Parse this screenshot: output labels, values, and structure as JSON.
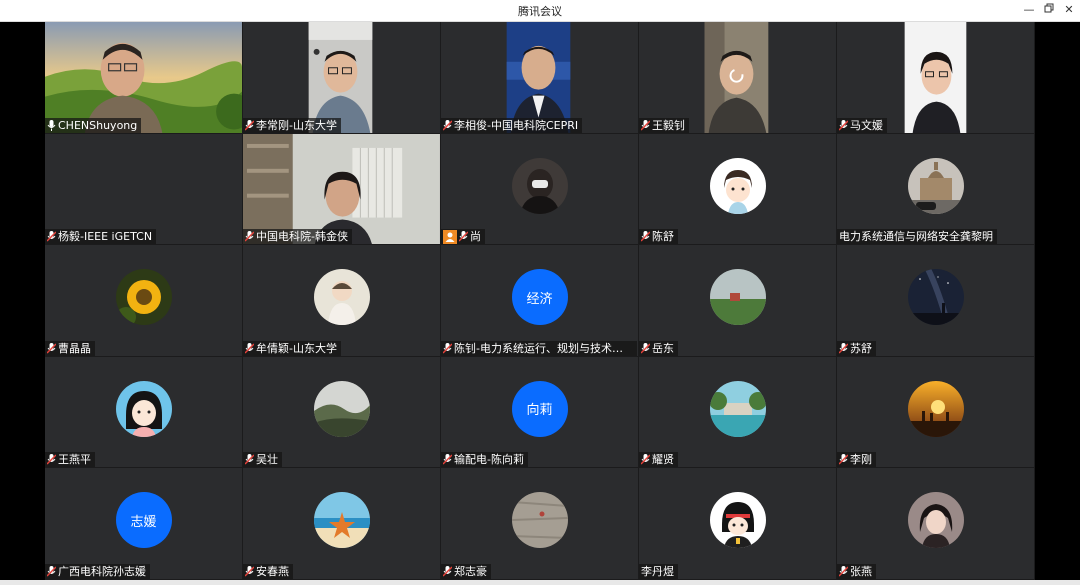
{
  "window": {
    "title": "腾讯会议",
    "minimize_icon": "minimize-icon",
    "restore_icon": "restore-icon",
    "close_icon": "close-icon"
  },
  "participants": [
    {
      "name": "CHENShuyong",
      "mic": "mic-on"
    },
    {
      "name": "李常刚-山东大学",
      "mic": "mic-muted"
    },
    {
      "name": "李相俊-中国电科院CEPRI",
      "mic": "mic-muted"
    },
    {
      "name": "王毅钊",
      "mic": "mic-muted"
    },
    {
      "name": "马文媛",
      "mic": "mic-muted"
    },
    {
      "name": "杨毅-IEEE iGETCN",
      "mic": "mic-muted"
    },
    {
      "name": "中国电科院-韩金侠",
      "mic": "mic-muted"
    },
    {
      "name": "尚",
      "mic": "mic-muted"
    },
    {
      "name": "陈舒",
      "mic": "mic-muted"
    },
    {
      "name": "电力系统通信与网络安全龚黎明",
      "mic": "none"
    },
    {
      "name": "曹晶晶",
      "mic": "mic-muted"
    },
    {
      "name": "牟倩颖-山东大学",
      "mic": "mic-muted"
    },
    {
      "name": "陈钊-电力系统运行、规划与技术经...",
      "mic": "mic-muted"
    },
    {
      "name": "岳东",
      "mic": "mic-muted"
    },
    {
      "name": "苏舒",
      "mic": "mic-muted"
    },
    {
      "name": "王燕平",
      "mic": "mic-muted"
    },
    {
      "name": "吴壮",
      "mic": "mic-muted"
    },
    {
      "name": "输配电-陈向莉",
      "mic": "mic-muted"
    },
    {
      "name": "耀贤",
      "mic": "mic-muted"
    },
    {
      "name": "李刚",
      "mic": "mic-muted"
    },
    {
      "name": "广西电科院孙志媛",
      "mic": "mic-muted"
    },
    {
      "name": "安春燕",
      "mic": "mic-muted"
    },
    {
      "name": "郑志豪",
      "mic": "mic-muted"
    },
    {
      "name": "李丹煜",
      "mic": "none"
    },
    {
      "name": "张燕",
      "mic": "mic-muted"
    }
  ],
  "avatar_text": {
    "p13": "经济",
    "p18": "向莉",
    "p21": "志媛"
  },
  "colors": {
    "accent_blue": "#0a6cff",
    "tile_bg": "#2b2c2e",
    "person_badge": "#f08a24"
  }
}
